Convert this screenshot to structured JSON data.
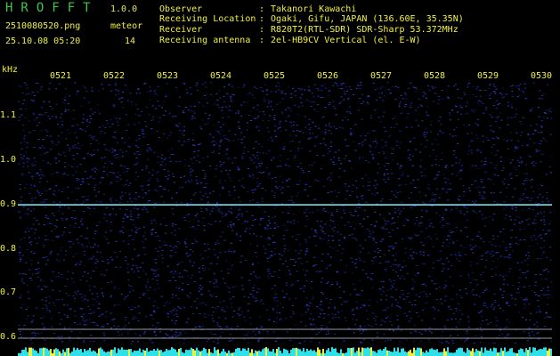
{
  "header": {
    "app_name": "HROFFT",
    "version": "1.0.0",
    "filename": "2510080520.png",
    "timestamp": "25.10.08 05:20",
    "meteor_label": "meteor",
    "meteor_count": "14"
  },
  "info": [
    {
      "key": "Observer",
      "value": "Takanori Kawachi"
    },
    {
      "key": "Receiving Location",
      "value": "Ogaki, Gifu, JAPAN (136.60E, 35.35N)"
    },
    {
      "key": "Receiver",
      "value": "R820T2(RTL-SDR) SDR-Sharp 53.372MHz"
    },
    {
      "key": "Receiving antenna",
      "value": "2el-HB9CV Vertical (el. E-W)"
    }
  ],
  "chart_data": {
    "type": "heatmap",
    "ylabel": "kHz",
    "x_ticks": [
      "0521",
      "0522",
      "0523",
      "0524",
      "0525",
      "0526",
      "0527",
      "0528",
      "0529",
      "0530"
    ],
    "y_ticks": [
      "1.1",
      "1.0",
      "0.9",
      "0.8",
      "0.7",
      "0.6"
    ],
    "ylim": [
      0.58,
      1.18
    ],
    "reference_line_khz": 0.9,
    "colors": {
      "background": "#000000",
      "noise": "#1a2fa0",
      "line": "#7ff0ff",
      "labels": "#f0f040"
    }
  }
}
